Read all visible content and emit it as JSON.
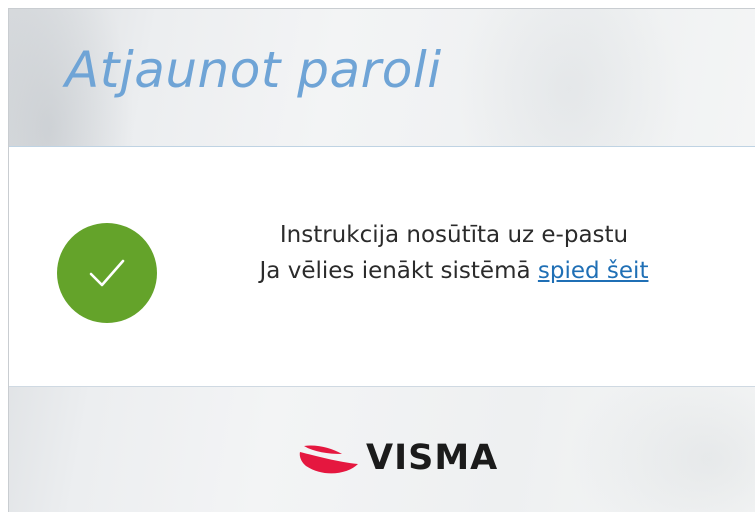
{
  "header": {
    "title": "Atjaunot paroli"
  },
  "status": {
    "icon": "checkmark-icon",
    "color": "#64a32a",
    "line1": "Instrukcija nosūtīta uz e-pastu",
    "line2_prefix": "Ja vēlies ienākt sistēmā",
    "link_label": "spied šeit"
  },
  "footer": {
    "logo_text": "VISMA",
    "logo_icon": "visma-swoosh-icon",
    "logo_color": "#e5173f"
  },
  "colors": {
    "title": "#6fa4d6",
    "link": "#1f6fb5"
  }
}
